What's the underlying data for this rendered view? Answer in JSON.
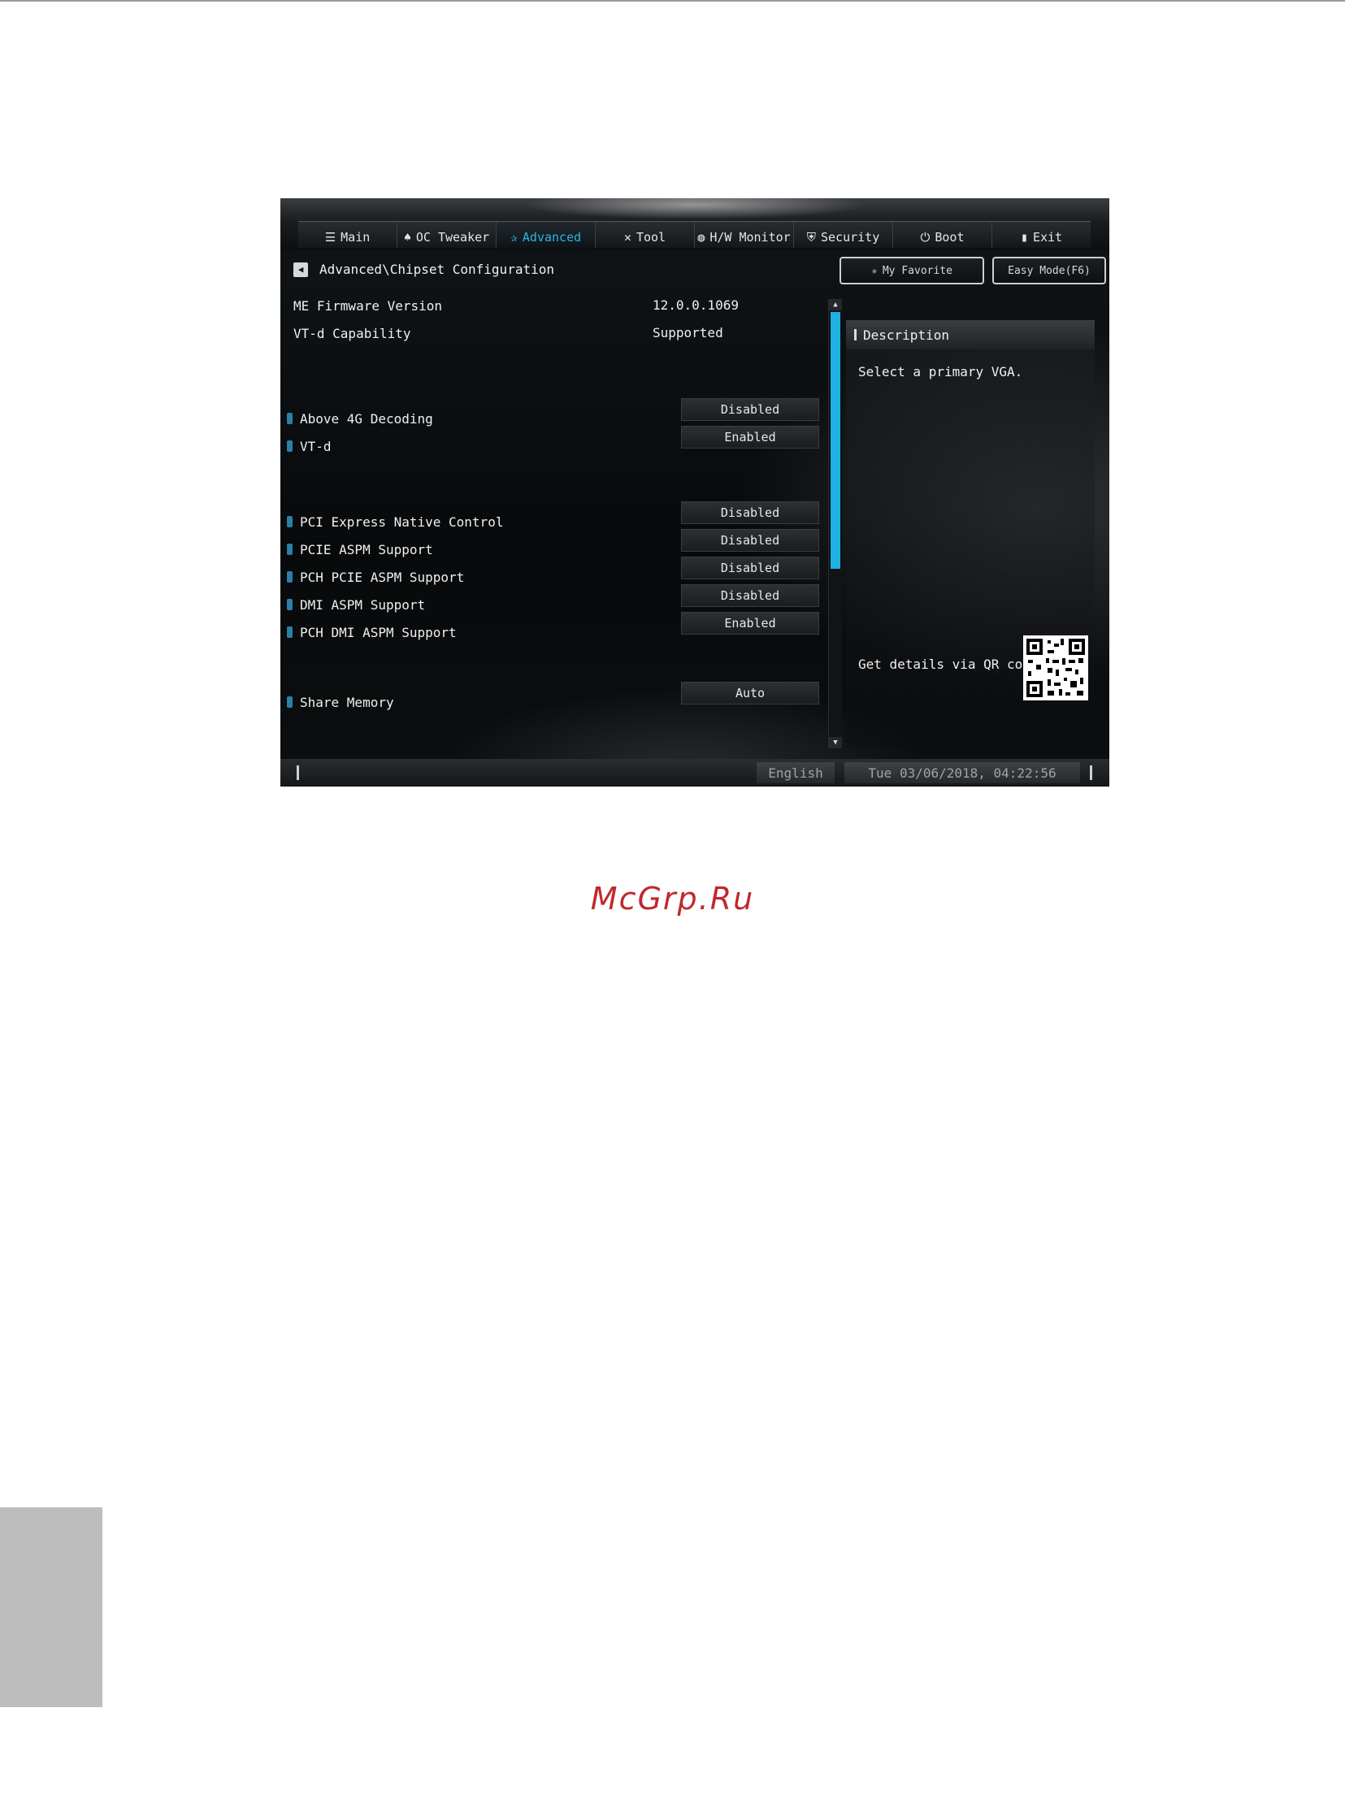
{
  "watermark": "McGrp.Ru",
  "bios": {
    "tabs": [
      {
        "label": "Main",
        "icon": "list-icon"
      },
      {
        "label": "OC Tweaker",
        "icon": "rocket-icon"
      },
      {
        "label": "Advanced",
        "icon": "star-icon"
      },
      {
        "label": "Tool",
        "icon": "tools-icon"
      },
      {
        "label": "H/W Monitor",
        "icon": "monitor-icon"
      },
      {
        "label": "Security",
        "icon": "shield-icon"
      },
      {
        "label": "Boot",
        "icon": "power-icon"
      },
      {
        "label": "Exit",
        "icon": "exit-icon"
      }
    ],
    "active_tab": "Advanced",
    "breadcrumb": "Advanced\\Chipset Configuration",
    "my_favorite": "My Favorite",
    "easy_mode": "Easy Mode(F6)",
    "info_rows": [
      {
        "label": "ME Firmware Version",
        "value": "12.0.0.1069"
      },
      {
        "label": "VT-d Capability",
        "value": "Supported"
      }
    ],
    "options": [
      {
        "label": "Above 4G Decoding",
        "value": "Disabled"
      },
      {
        "label": "VT-d",
        "value": "Enabled"
      },
      {
        "label": "PCI Express Native Control",
        "value": "Disabled"
      },
      {
        "label": "PCIE ASPM Support",
        "value": "Disabled"
      },
      {
        "label": "PCH PCIE ASPM Support",
        "value": "Disabled"
      },
      {
        "label": "DMI ASPM Support",
        "value": "Disabled"
      },
      {
        "label": "PCH DMI ASPM Support",
        "value": "Enabled"
      },
      {
        "label": "Share Memory",
        "value": "Auto"
      }
    ],
    "description_title": "Description",
    "description_text": "Select a primary VGA.",
    "qr_label": "Get details via QR code",
    "language": "English",
    "datetime": "Tue 03/06/2018, 04:22:56",
    "accent_color": "#1fb0e4"
  }
}
